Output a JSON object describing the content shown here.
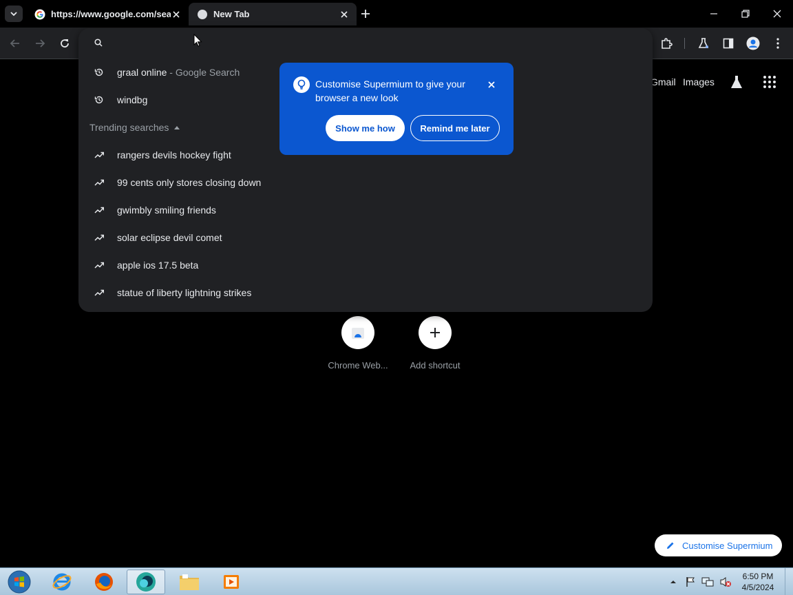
{
  "browser": {
    "tabs": [
      {
        "title": "https://www.google.com/search",
        "active": false
      },
      {
        "title": "New Tab",
        "active": true
      }
    ],
    "icons": {
      "tab_search": "chevron-down-icon",
      "new_tab": "plus-icon",
      "back": "arrow-left-icon",
      "forward": "arrow-right-icon",
      "reload": "reload-icon",
      "extensions": "puzzle-icon",
      "labs": "flask-icon",
      "side_panel": "side-panel-icon",
      "profile": "profile-icon",
      "menu": "kebab-menu-icon"
    }
  },
  "omnibox": {
    "input_value": "",
    "history": [
      {
        "text": "graal online",
        "suffix": " - Google Search",
        "icon": "history-icon"
      },
      {
        "text": "windbg",
        "suffix": "",
        "icon": "history-icon"
      }
    ],
    "trending_header": "Trending searches",
    "trending": [
      {
        "text": "rangers devils hockey fight",
        "icon": "trending-icon"
      },
      {
        "text": "99 cents only stores closing down",
        "icon": "trending-icon"
      },
      {
        "text": "gwimbly smiling friends",
        "icon": "trending-icon"
      },
      {
        "text": "solar eclipse devil comet",
        "icon": "trending-icon"
      },
      {
        "text": "apple ios 17.5 beta",
        "icon": "trending-icon"
      },
      {
        "text": "statue of liberty lightning strikes",
        "icon": "trending-icon"
      }
    ]
  },
  "bubble": {
    "message": "Customise Supermium to give your browser a new look",
    "show_me_how": "Show me how",
    "remind_later": "Remind me later"
  },
  "ntp": {
    "gmail": "Gmail",
    "images": "Images",
    "shortcuts": [
      {
        "label": "Chrome Web..."
      },
      {
        "label": "Add shortcut"
      }
    ],
    "customise_button": "Customise Supermium"
  },
  "taskbar": {
    "items": [
      "start-orb",
      "internet-explorer",
      "firefox",
      "supermium",
      "file-explorer",
      "media-player"
    ],
    "time": "6:50 PM",
    "date": "4/5/2024"
  },
  "colors": {
    "bubble_bg": "#0b57d0",
    "omnibox_bg": "#202124",
    "page_bg": "#000000",
    "accent": "#1a73e8"
  }
}
